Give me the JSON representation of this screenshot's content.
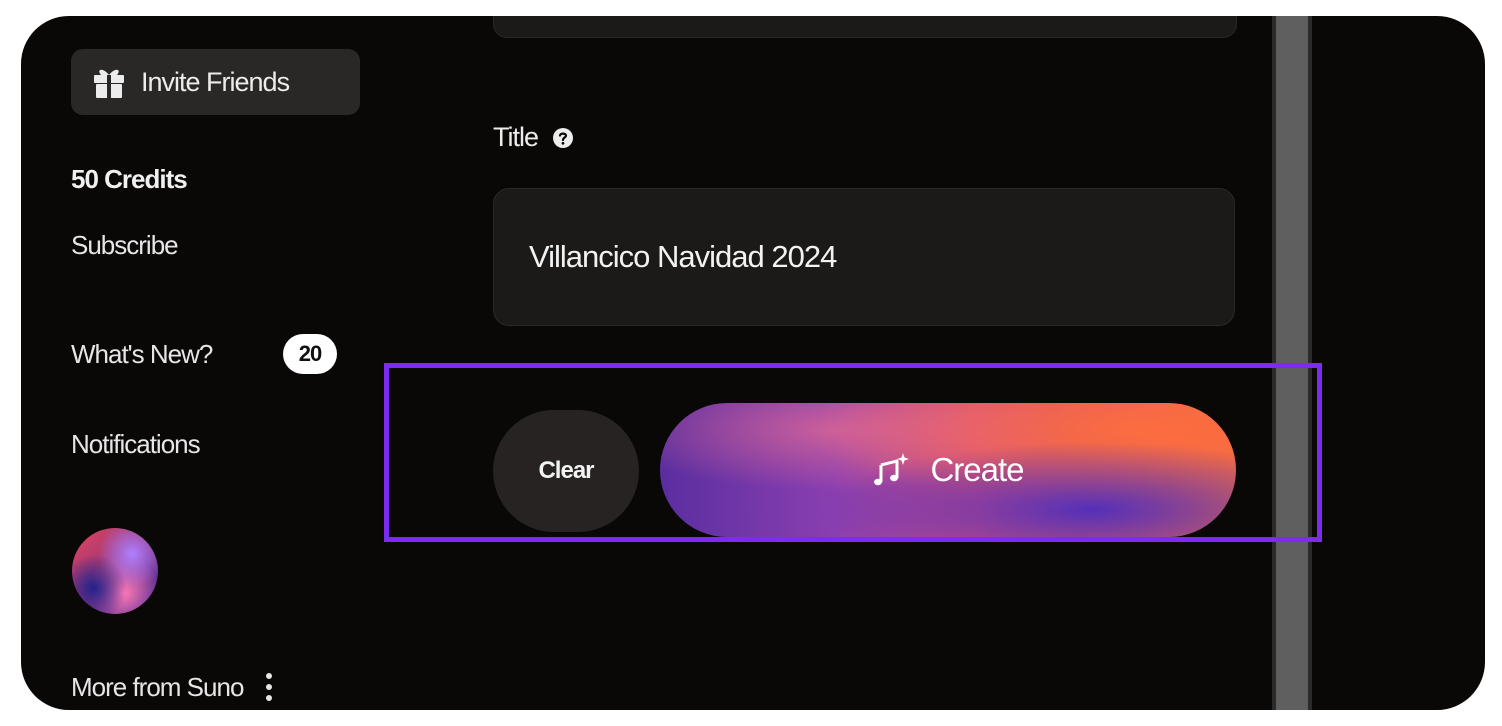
{
  "sidebar": {
    "invite_label": "Invite Friends",
    "credits": "50 Credits",
    "subscribe": "Subscribe",
    "whats_new": "What's New?",
    "whats_new_count": "20",
    "notifications": "Notifications",
    "more_from": "More from Suno"
  },
  "form": {
    "title_label": "Title",
    "title_value": "Villancico Navidad 2024"
  },
  "actions": {
    "clear_label": "Clear",
    "create_label": "Create"
  },
  "colors": {
    "background": "#0a0707",
    "highlight": "#7b2cf0",
    "create_gradient_start": "#5a2ea0",
    "create_gradient_end": "#f06a45"
  },
  "icons": {
    "invite": "gift-icon",
    "help": "question-circle-icon",
    "create": "music-sparkle-icon",
    "more": "kebab-menu-icon"
  }
}
